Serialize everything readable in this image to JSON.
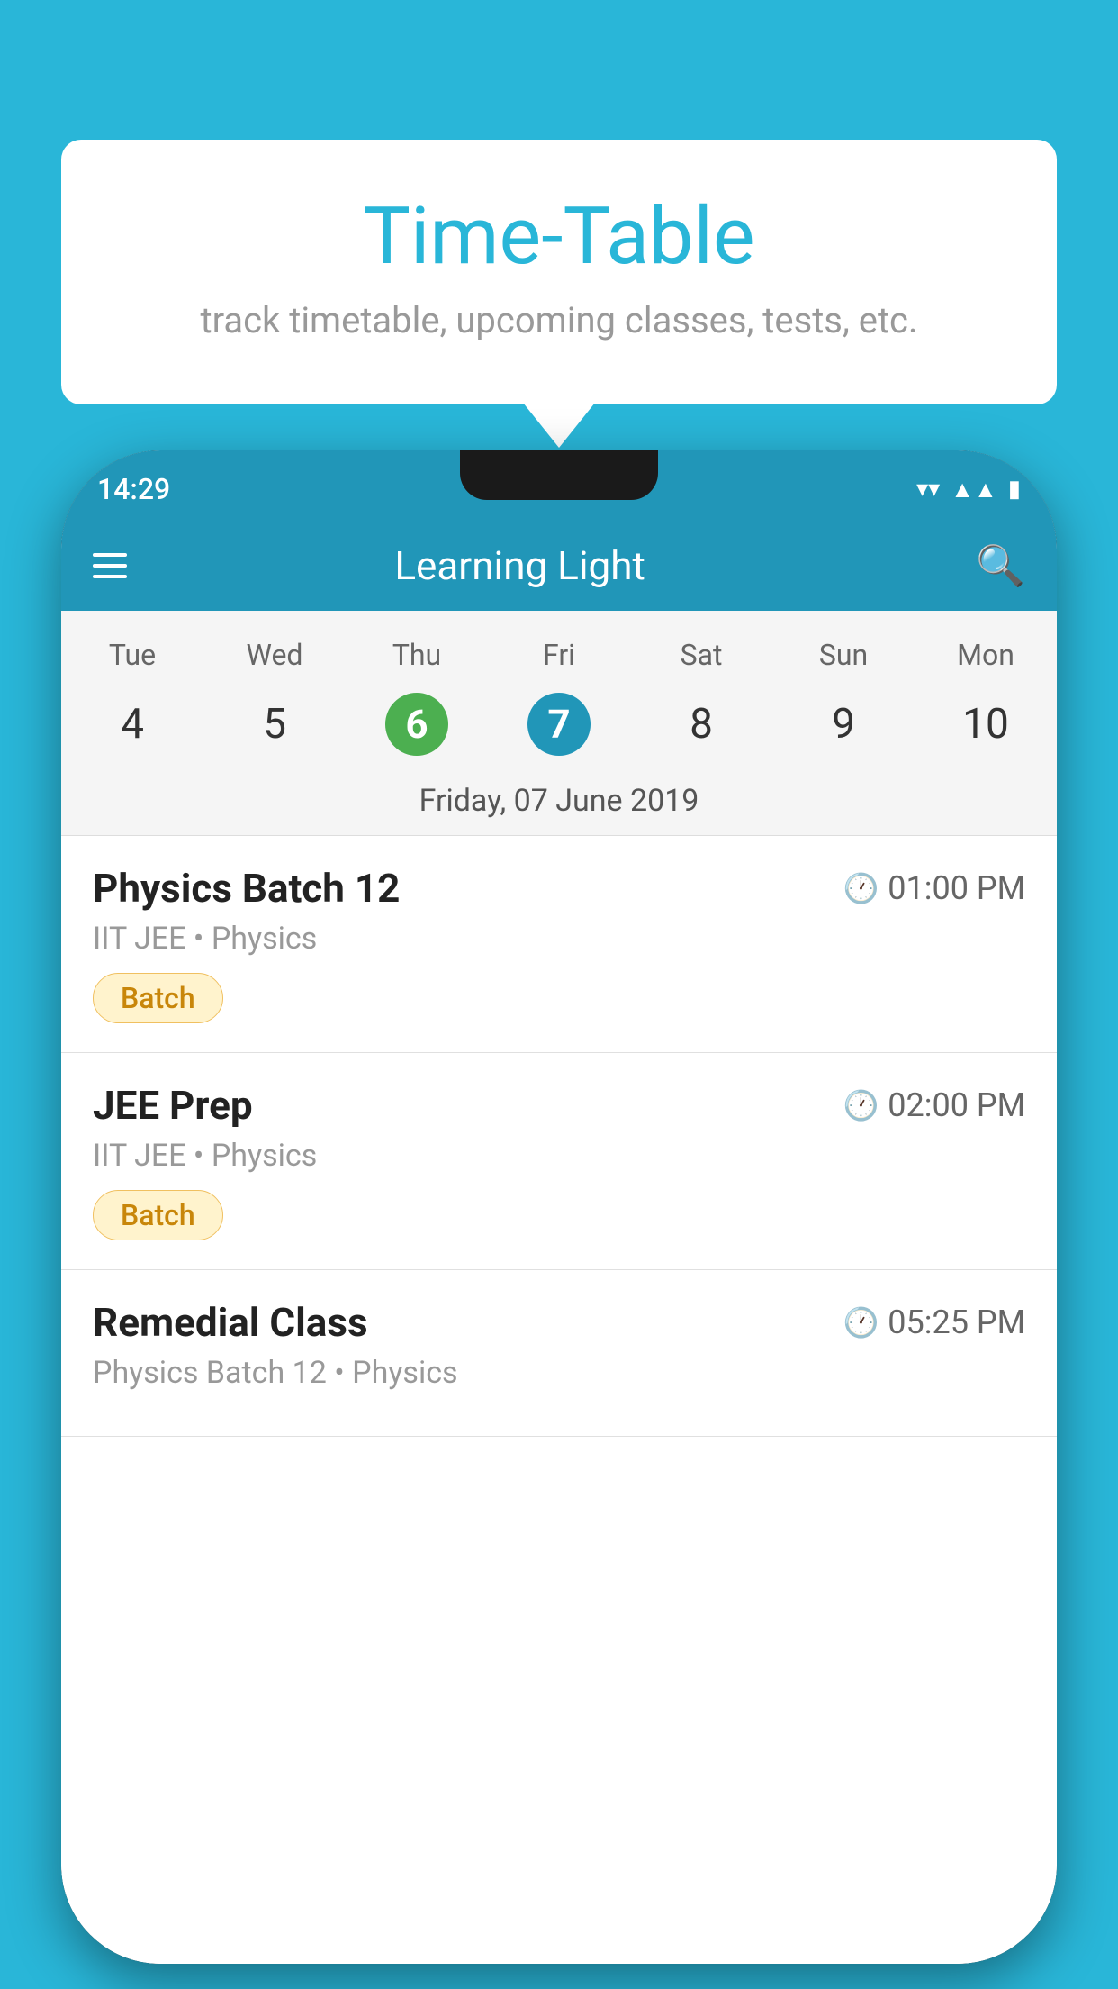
{
  "background": {
    "color": "#29b6d8"
  },
  "tooltip": {
    "title": "Time-Table",
    "subtitle": "track timetable, upcoming classes, tests, etc."
  },
  "phone": {
    "statusBar": {
      "time": "14:29"
    },
    "appBar": {
      "title": "Learning Light"
    },
    "calendar": {
      "days": [
        {
          "abbr": "Tue",
          "num": "4",
          "style": "plain"
        },
        {
          "abbr": "Wed",
          "num": "5",
          "style": "plain"
        },
        {
          "abbr": "Thu",
          "num": "6",
          "style": "green"
        },
        {
          "abbr": "Fri",
          "num": "7",
          "style": "blue"
        },
        {
          "abbr": "Sat",
          "num": "8",
          "style": "plain"
        },
        {
          "abbr": "Sun",
          "num": "9",
          "style": "plain"
        },
        {
          "abbr": "Mon",
          "num": "10",
          "style": "plain"
        }
      ],
      "selectedDate": "Friday, 07 June 2019"
    },
    "schedule": [
      {
        "name": "Physics Batch 12",
        "time": "01:00 PM",
        "meta": "IIT JEE • Physics",
        "badge": "Batch"
      },
      {
        "name": "JEE Prep",
        "time": "02:00 PM",
        "meta": "IIT JEE • Physics",
        "badge": "Batch"
      },
      {
        "name": "Remedial Class",
        "time": "05:25 PM",
        "meta": "Physics Batch 12 • Physics",
        "badge": null
      }
    ]
  }
}
